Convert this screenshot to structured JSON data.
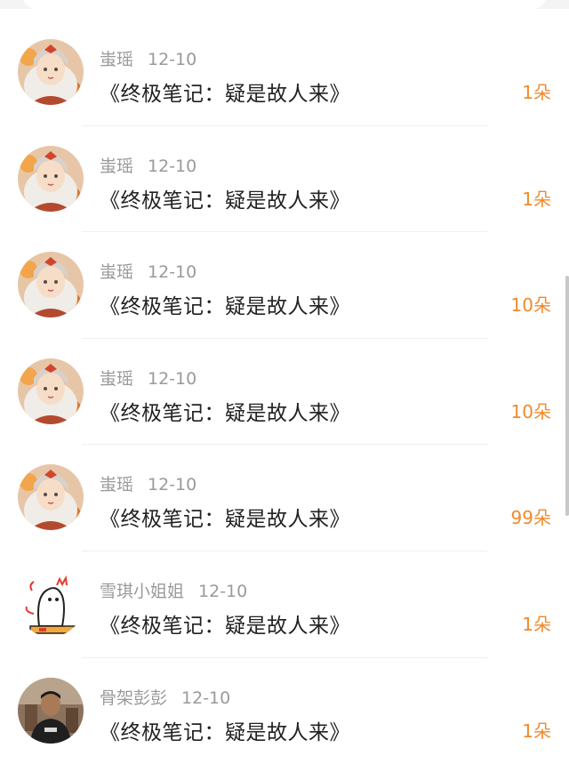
{
  "items": [
    {
      "user": "蚩瑶",
      "date": "12-10",
      "title": "《终极笔记：疑是故人来》",
      "count": "1朵",
      "avatar": "girl-avatar-icon"
    },
    {
      "user": "蚩瑶",
      "date": "12-10",
      "title": "《终极笔记：疑是故人来》",
      "count": "1朵",
      "avatar": "girl-avatar-icon"
    },
    {
      "user": "蚩瑶",
      "date": "12-10",
      "title": "《终极笔记：疑是故人来》",
      "count": "10朵",
      "avatar": "girl-avatar-icon"
    },
    {
      "user": "蚩瑶",
      "date": "12-10",
      "title": "《终极笔记：疑是故人来》",
      "count": "10朵",
      "avatar": "girl-avatar-icon"
    },
    {
      "user": "蚩瑶",
      "date": "12-10",
      "title": "《终极笔记：疑是故人来》",
      "count": "99朵",
      "avatar": "girl-avatar-icon"
    },
    {
      "user": "雪琪小姐姐",
      "date": "12-10",
      "title": "《终极笔记：疑是故人来》",
      "count": "1朵",
      "avatar": "cartoon-ghost-avatar-icon"
    },
    {
      "user": "骨架彭彭",
      "date": "12-10",
      "title": "《终极笔记：疑是故人来》",
      "count": "1朵",
      "avatar": "man-photo-avatar-icon"
    }
  ],
  "colors": {
    "accent": "#f08a2c",
    "meta": "#9a9a9a",
    "title": "#222222"
  }
}
